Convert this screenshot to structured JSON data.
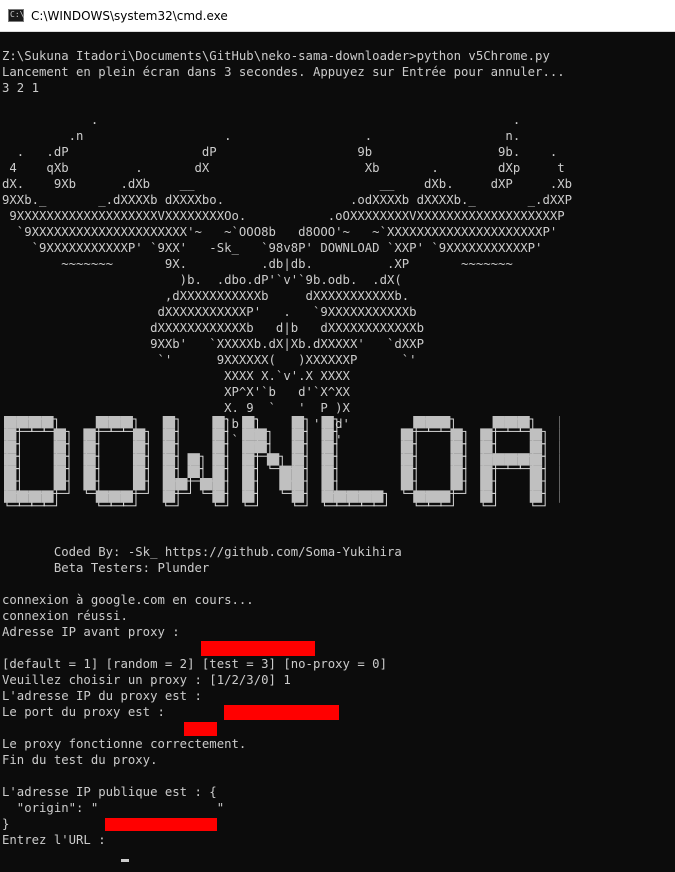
{
  "window": {
    "title": "C:\\WINDOWS\\system32\\cmd.exe",
    "icon": "cmd-console-icon",
    "icon_glyph": "C:\\"
  },
  "console": {
    "lines": [
      "Z:\\Sukuna Itadori\\Documents\\GitHub\\neko-sama-downloader>python v5Chrome.py",
      "Lancement en plein écran dans 3 secondes. Appuyez sur Entrée pour annuler...",
      "3 2 1",
      "",
      "            .                                                        .",
      "         .n                   .                  .                  n.",
      "  .   .dP                  dP                   9b                 9b.    .",
      " 4    qXb         .       dX                     Xb       .        dXp     t",
      "dX.    9Xb      .dXb    __                         __    dXb.     dXP     .Xb",
      "9XXb._       _.dXXXXb dXXXXbo.                 .odXXXXb dXXXXb._       _.dXXP",
      " 9XXXXXXXXXXXXXXXXXXXVXXXXXXXXOo.           .oOXXXXXXXXVXXXXXXXXXXXXXXXXXXXP",
      "  `9XXXXXXXXXXXXXXXXXXXXX'~   ~`OOO8b   d8OOO'~   ~`XXXXXXXXXXXXXXXXXXXXXP'",
      "    `9XXXXXXXXXXXP' `9XX'   -Sk_   `98v8P' DOWNLOAD `XXP' `9XXXXXXXXXXXP'",
      "        ~~~~~~~       9X.          .db|db.          .XP       ~~~~~~~",
      "                        )b.  .dbo.dP'`v'`9b.odb.  .dX(",
      "                      ,dXXXXXXXXXXXb     dXXXXXXXXXXXb.",
      "                     dXXXXXXXXXXXP'   .   `9XXXXXXXXXXXb",
      "                    dXXXXXXXXXXXXb   d|b   dXXXXXXXXXXXXb",
      "                    9XXb'   `XXXXXb.dX|Xb.dXXXXX'   `dXXP",
      "                     `'      9XXXXXX(   )XXXXXXP      `'",
      "                              XXXX X.`v'.X XXXX",
      "                              XP^X'`b   d'`X^XX",
      "                              X. 9  `   '  P )X",
      "                              `b  `       '  d'",
      "                               `             '",
      "",
      "",
      "",
      "",
      "",
      "",
      "       Coded By: -Sk_ https://github.com/Soma-Yukihira",
      "       Beta Testers: Plunder",
      "",
      "connexion à google.com en cours...",
      "connexion réussi.",
      "Adresse IP avant proxy : ",
      "",
      "[default = 1] [random = 2] [test = 3] [no-proxy = 0]",
      "Veuillez choisir un proxy : [1/2/3/0] 1",
      "L'adresse IP du proxy est : ",
      "Le port du proxy est : ",
      "",
      "Le proxy fonctionne correctement.",
      "Fin du test du proxy.",
      "",
      "L'adresse IP publique est : {",
      "  \"origin\": \"                \"",
      "}",
      "Entrez l'URL : "
    ],
    "banner_text": "DOWNLOAD",
    "colors": {
      "background": "#0c0c0c",
      "text": "#cccccc",
      "redaction": "#ff0000",
      "banner_fill": "#c0c0c0",
      "banner_outline": "#d8d8d8"
    }
  }
}
